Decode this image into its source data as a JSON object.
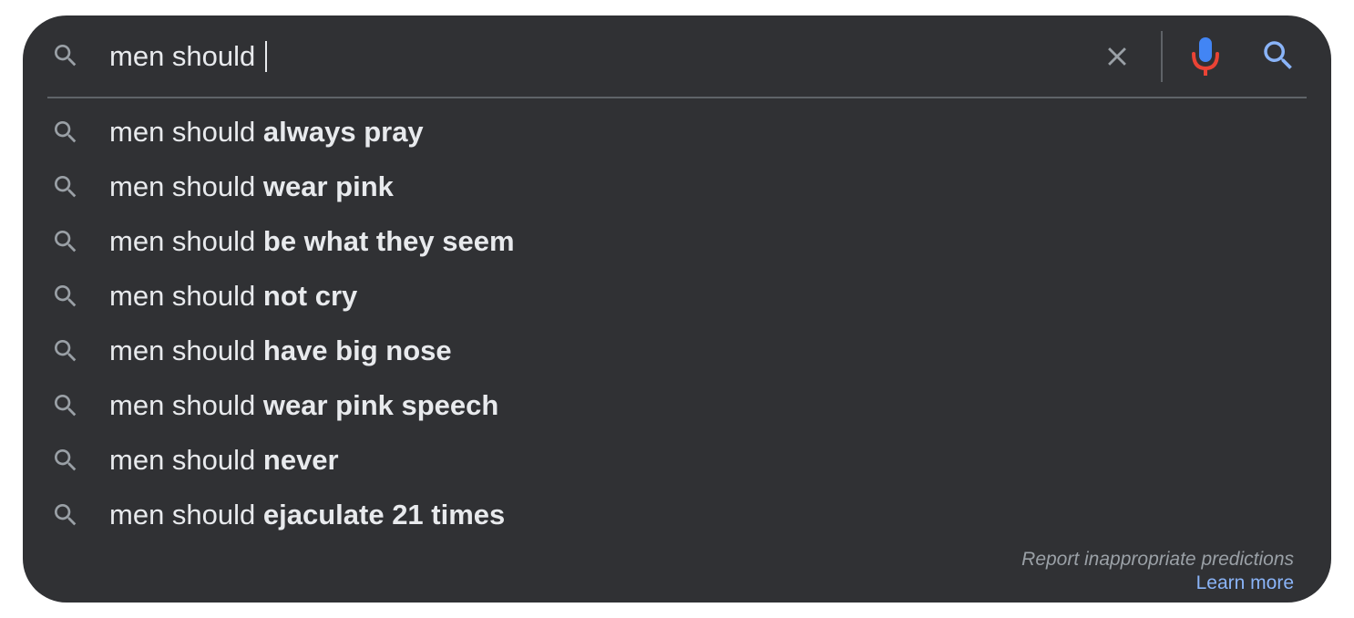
{
  "search": {
    "query": "men should ",
    "icons": {
      "leading": "search-icon",
      "clear": "close-icon",
      "voice": "microphone-icon",
      "submit": "search-icon"
    }
  },
  "suggestions": [
    {
      "prefix": "men should ",
      "completion": "always pray"
    },
    {
      "prefix": "men should ",
      "completion": "wear pink"
    },
    {
      "prefix": "men should ",
      "completion": "be what they seem"
    },
    {
      "prefix": "men should ",
      "completion": "not cry"
    },
    {
      "prefix": "men should ",
      "completion": "have big nose"
    },
    {
      "prefix": "men should ",
      "completion": "wear pink speech"
    },
    {
      "prefix": "men should ",
      "completion": "never"
    },
    {
      "prefix": "men should ",
      "completion": "ejaculate 21 times"
    }
  ],
  "footer": {
    "report": "Report inappropriate predictions",
    "learn_more": "Learn more"
  },
  "colors": {
    "panel": "#303134",
    "text": "#e8eaed",
    "muted_icon": "#9aa0a6",
    "divider": "#5f6368",
    "link": "#8ab4f8",
    "mic_blue": "#4285f4",
    "mic_red": "#ea4335"
  }
}
